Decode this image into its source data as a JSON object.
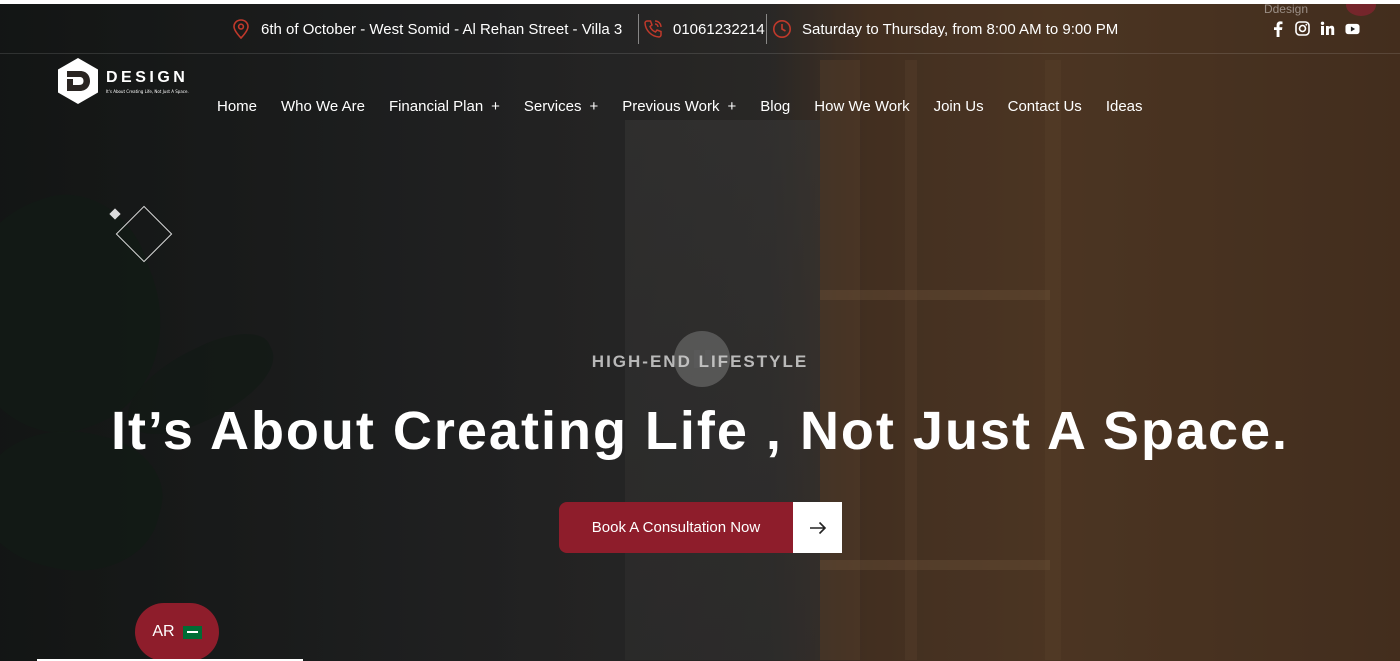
{
  "top_bar": {
    "address": "6th of October - West Somid - Al Rehan Street - Villa 3",
    "phone": "01061232214",
    "hours": "Saturday to Thursday, from 8:00 AM to 9:00 PM",
    "faint_label": "Ddesign",
    "social_icons": [
      "facebook-icon",
      "instagram-icon",
      "linkedin-icon",
      "youtube-icon"
    ]
  },
  "logo": {
    "word": "DESIGN",
    "tagline": "It's About Creating Life, Not Just A Space."
  },
  "nav": {
    "items": [
      {
        "label": "Home",
        "has_submenu": false
      },
      {
        "label": "Who We Are",
        "has_submenu": false
      },
      {
        "label": "Financial Plan",
        "has_submenu": true
      },
      {
        "label": "Services",
        "has_submenu": true
      },
      {
        "label": "Previous Work",
        "has_submenu": true
      },
      {
        "label": "Blog",
        "has_submenu": false
      },
      {
        "label": "How We Work",
        "has_submenu": false
      },
      {
        "label": "Join Us",
        "has_submenu": false
      },
      {
        "label": "Contact Us",
        "has_submenu": false
      },
      {
        "label": "Ideas",
        "has_submenu": false
      }
    ],
    "submenu_glyph": "+"
  },
  "hero": {
    "eyebrow": "HIGH-END LIFESTYLE",
    "headline": "It’s About Creating Life , Not Just A Space.",
    "cta_label": "Book A Consultation Now",
    "slide_progress": 0.19
  },
  "language_toggle": {
    "label": "AR",
    "flag": "saudi-flag-icon"
  },
  "colors": {
    "brand": "#8e1d2b",
    "icon_accent": "#c0392b",
    "text": "#ffffff"
  }
}
